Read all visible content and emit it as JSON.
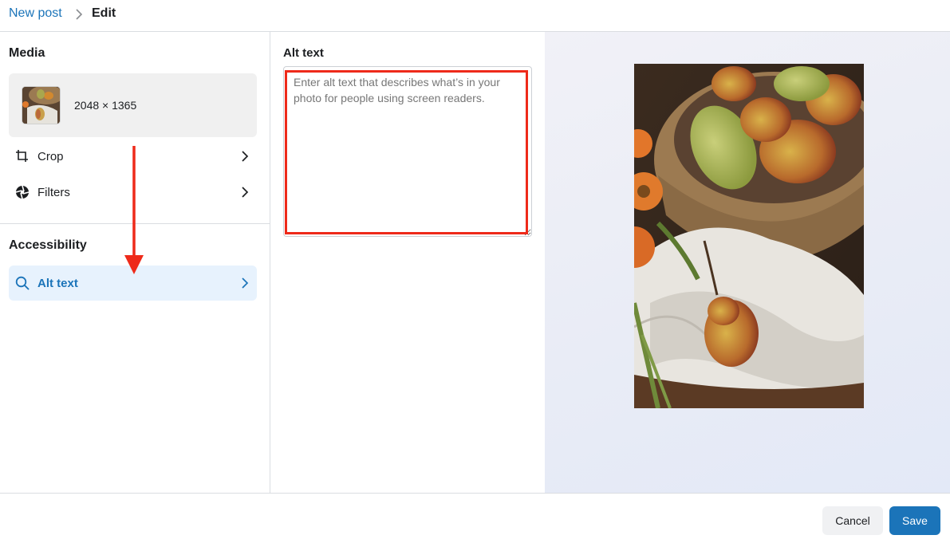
{
  "breadcrumb": {
    "parent": "New post",
    "current": "Edit"
  },
  "left_panel": {
    "media_title": "Media",
    "media_dims": "2048 × 1365",
    "items": [
      {
        "label": "Crop",
        "icon": "crop-icon"
      },
      {
        "label": "Filters",
        "icon": "filters-icon"
      }
    ],
    "accessibility_title": "Accessibility",
    "alt_item": {
      "label": "Alt text",
      "icon": "search-icon"
    }
  },
  "alt_editor": {
    "title": "Alt text",
    "placeholder": "Enter alt text that describes what’s in your photo for people using screen readers.",
    "value": ""
  },
  "footer": {
    "cancel_label": "Cancel",
    "save_label": "Save"
  },
  "colors": {
    "accent": "#1b74b9",
    "highlight": "#ee2a1a",
    "selected_bg": "#e7f2fd"
  }
}
